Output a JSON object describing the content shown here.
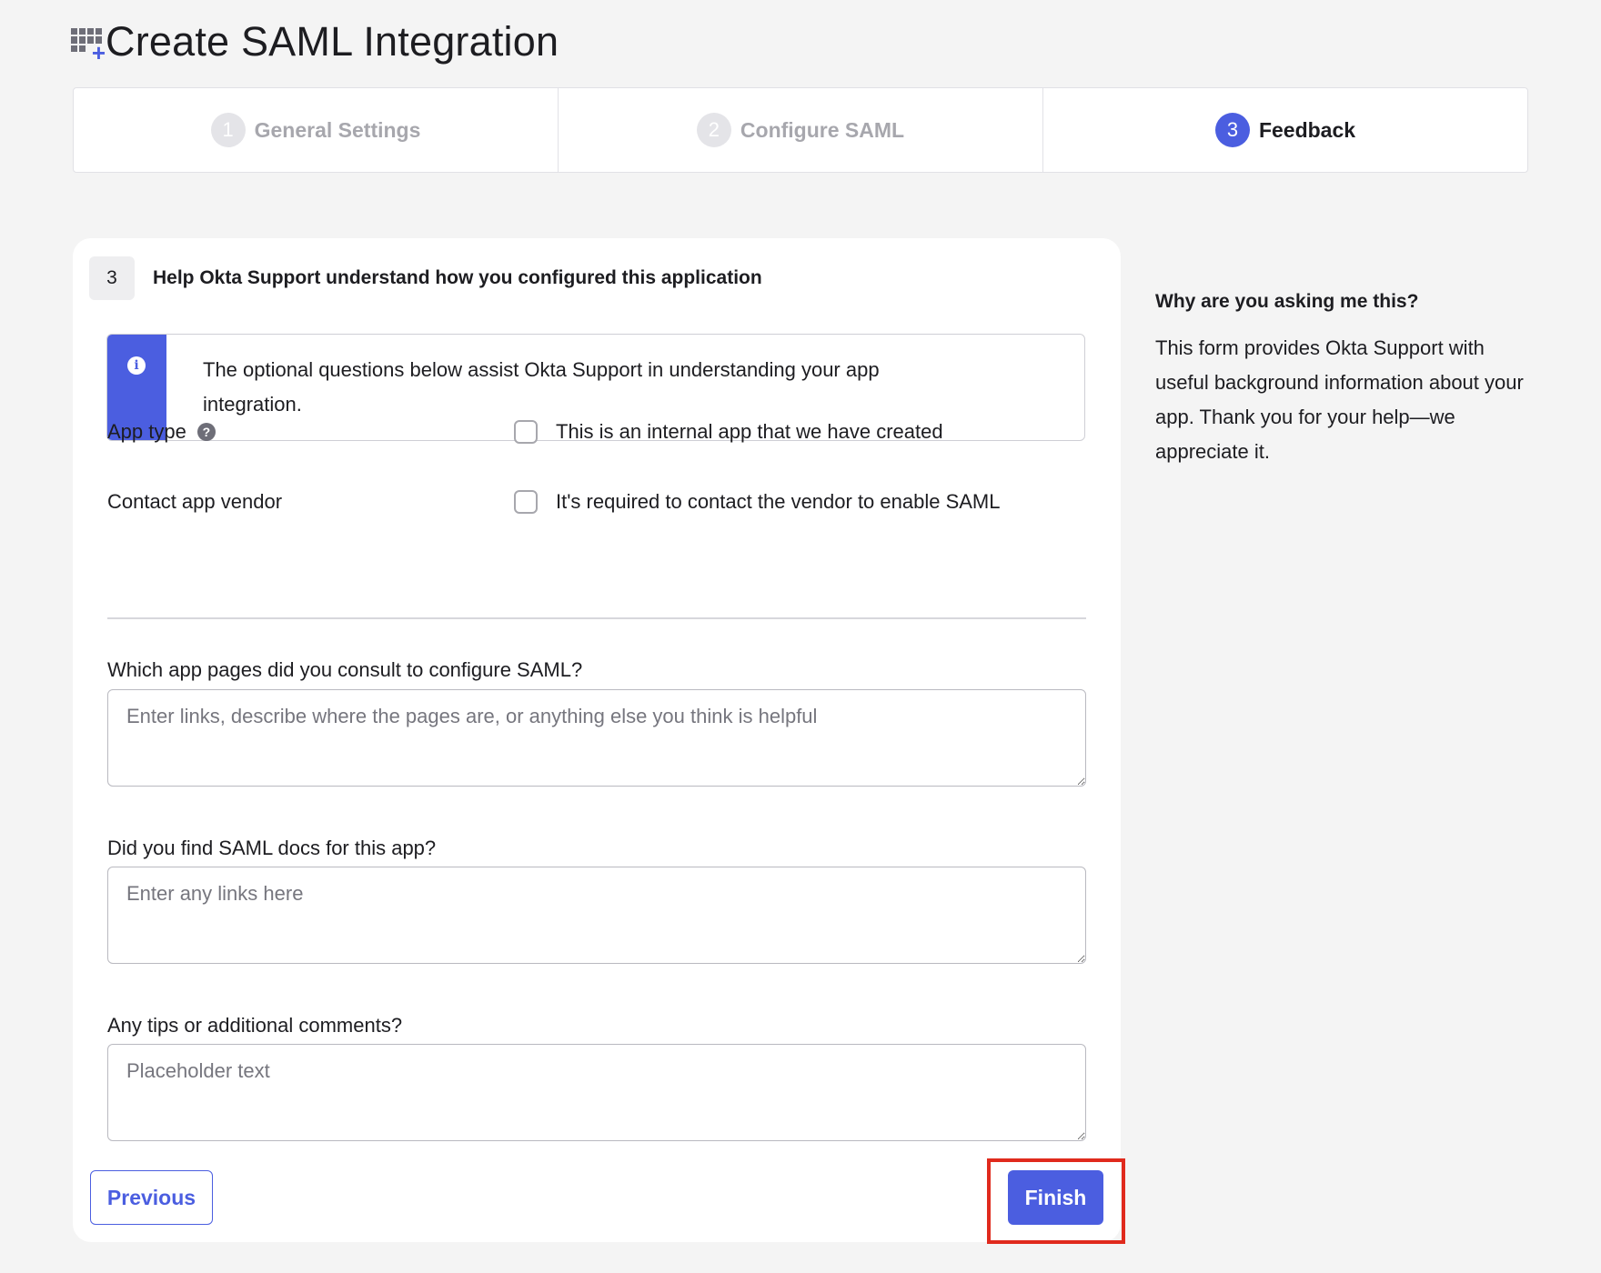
{
  "header": {
    "title": "Create SAML Integration",
    "icon": "app-grid-plus-icon"
  },
  "stepper": {
    "steps": [
      {
        "number": "1",
        "label": "General Settings",
        "active": false
      },
      {
        "number": "2",
        "label": "Configure SAML",
        "active": false
      },
      {
        "number": "3",
        "label": "Feedback",
        "active": true
      }
    ]
  },
  "section": {
    "number": "3",
    "title": "Help Okta Support understand how you configured this application"
  },
  "callout": {
    "icon": "info-icon",
    "text": "The optional questions below assist Okta Support in understanding your app integration."
  },
  "fields": {
    "app_type": {
      "label": "App type",
      "checkbox_label": "This is an internal app that we have created",
      "checked": false
    },
    "contact_vendor": {
      "label": "Contact app vendor",
      "checkbox_label": "It's required to contact the vendor to enable SAML",
      "checked": false
    }
  },
  "questions": {
    "pages": {
      "label": "Which app pages did you consult to configure SAML?",
      "placeholder": "Enter links, describe where the pages are, or anything else you think is helpful",
      "value": ""
    },
    "docs": {
      "label": "Did you find SAML docs for this app?",
      "placeholder": "Enter any links here",
      "value": ""
    },
    "tips": {
      "label": "Any tips or additional comments?",
      "placeholder": "Placeholder text",
      "value": ""
    }
  },
  "buttons": {
    "previous": "Previous",
    "finish": "Finish"
  },
  "side": {
    "title": "Why are you asking me this?",
    "body": "This form provides Okta Support with useful background information about your app. Thank you for your help—we appreciate it."
  },
  "colors": {
    "accent": "#4b5ee0",
    "highlight": "#e02a1d",
    "background": "#f4f4f4"
  }
}
